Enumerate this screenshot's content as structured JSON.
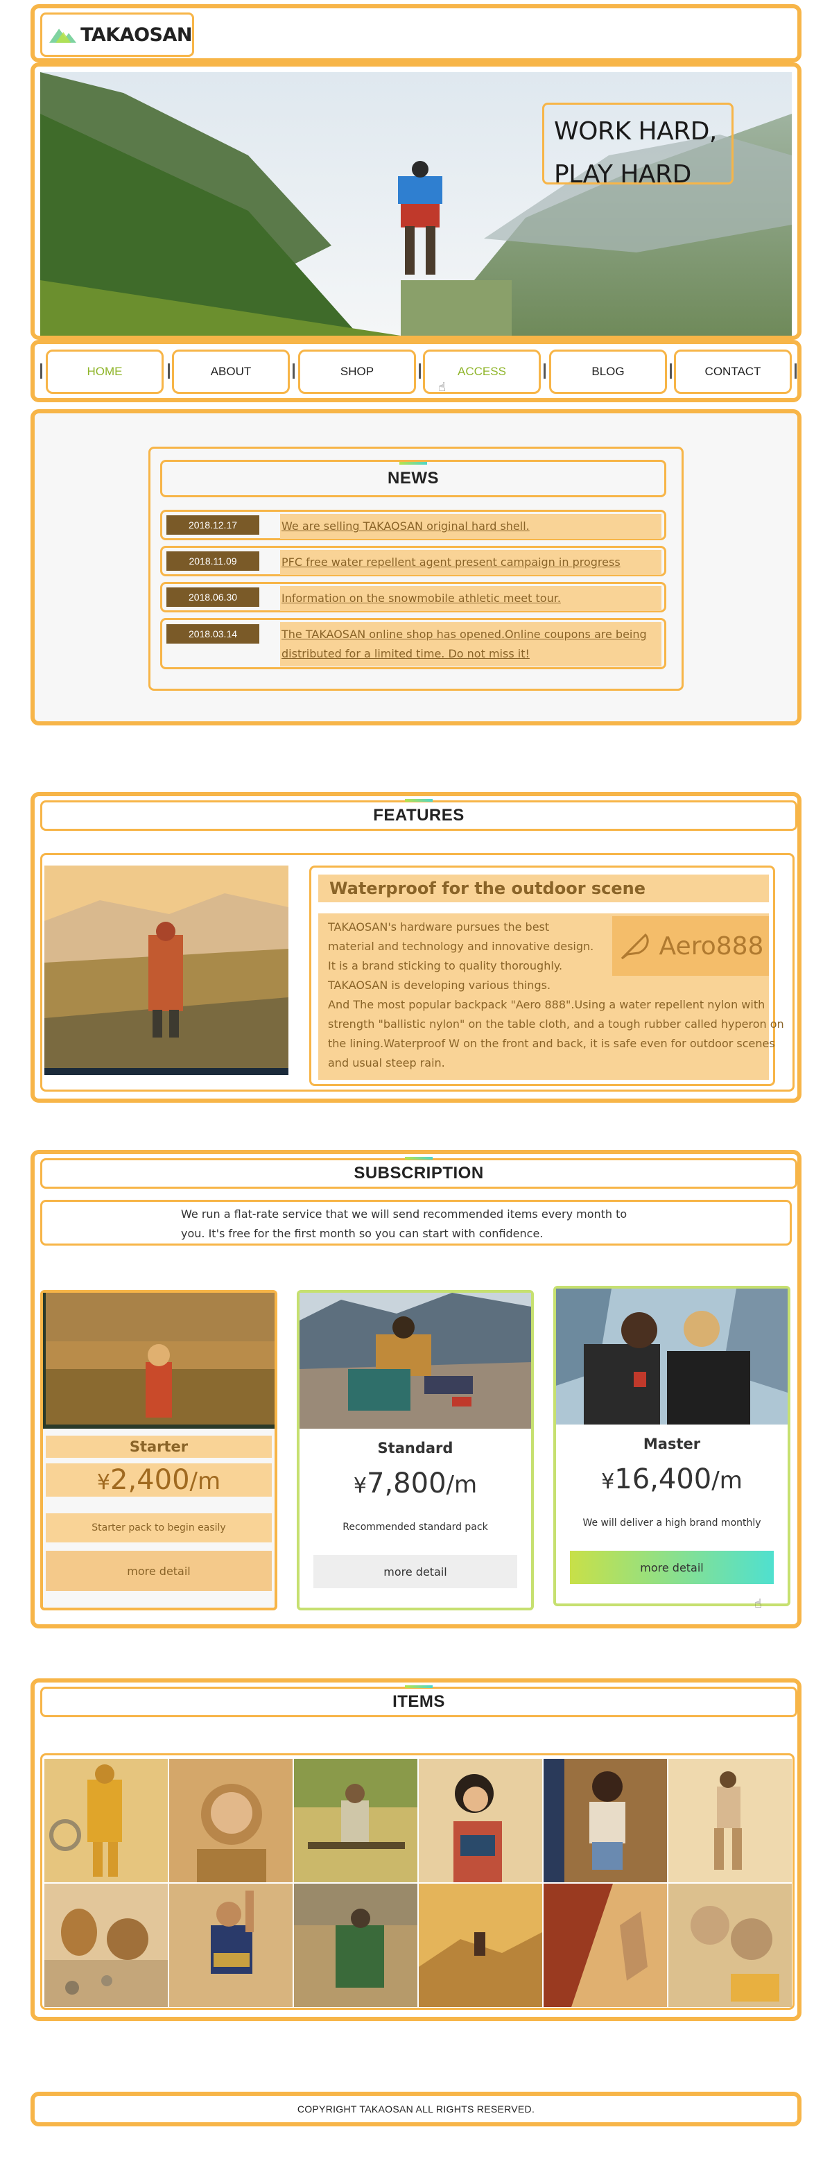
{
  "header": {
    "brand": "TAKAOSAN",
    "logo_icon": "mountain-logo-icon"
  },
  "hero": {
    "tagline_line1": "WORK HARD,",
    "tagline_line2": "PLAY HARD"
  },
  "nav": {
    "items": [
      {
        "label": "HOME",
        "active": true
      },
      {
        "label": "ABOUT",
        "active": false
      },
      {
        "label": "SHOP",
        "active": false
      },
      {
        "label": "ACCESS",
        "active": true
      },
      {
        "label": "BLOG",
        "active": false
      },
      {
        "label": "CONTACT",
        "active": false
      }
    ]
  },
  "news": {
    "title": "NEWS",
    "items": [
      {
        "date": "2018.12.17",
        "text": "We are selling TAKAOSAN original hard shell."
      },
      {
        "date": "2018.11.09",
        "text": "PFC free water repellent agent present campaign in progress"
      },
      {
        "date": "2018.06.30",
        "text": "Information on the snowmobile athletic meet tour."
      },
      {
        "date": "2018.03.14",
        "text": "The TAKAOSAN online shop has opened.Online coupons are being distributed for a limited time. Do not miss it!"
      }
    ]
  },
  "features": {
    "title": "FEATURES",
    "heading": "Waterproof for the outdoor scene",
    "badge": "Aero888",
    "badge_icon": "feather-icon",
    "lines": [
      "TAKAOSAN's hardware pursues the best",
      "material and technology and innovative design.",
      "It is a brand sticking to quality thoroughly.",
      "TAKAOSAN is developing various things.",
      "And The most popular backpack \"Aero 888\".Using a water repellent nylon with",
      "strength \"ballistic nylon\" on the table cloth, and a tough rubber called hyperon on",
      "the lining.Waterproof W on the front and back, it is safe even for outdoor scenes",
      "and usual steep rain."
    ]
  },
  "subscription": {
    "title": "SUBSCRIPTION",
    "desc_line1": "We run a flat-rate service that we will send recommended items every month to",
    "desc_line2": "you. It's free for the first month so you can start with confidence.",
    "plans": [
      {
        "name": "Starter",
        "yen": "¥",
        "price": "2,400",
        "per": "/m",
        "tagline": "Starter pack to begin easily",
        "button": "more detail"
      },
      {
        "name": "Standard",
        "yen": "¥",
        "price": "7,800",
        "per": "/m",
        "tagline": "Recommended standard pack",
        "button": "more detail"
      },
      {
        "name": "Master",
        "yen": "¥",
        "price": "16,400",
        "per": "/m",
        "tagline": "We will deliver a high brand monthly",
        "button": "more detail"
      }
    ]
  },
  "items": {
    "title": "ITEMS"
  },
  "footer": {
    "copyright": "COPYRIGHT TAKAOSAN ALL RIGHTS RESERVED."
  },
  "colors": {
    "outline": "#f7b548",
    "accent_green": "#8fb52a",
    "highlight": "#f9d396",
    "date_bg": "#7a5a28"
  }
}
